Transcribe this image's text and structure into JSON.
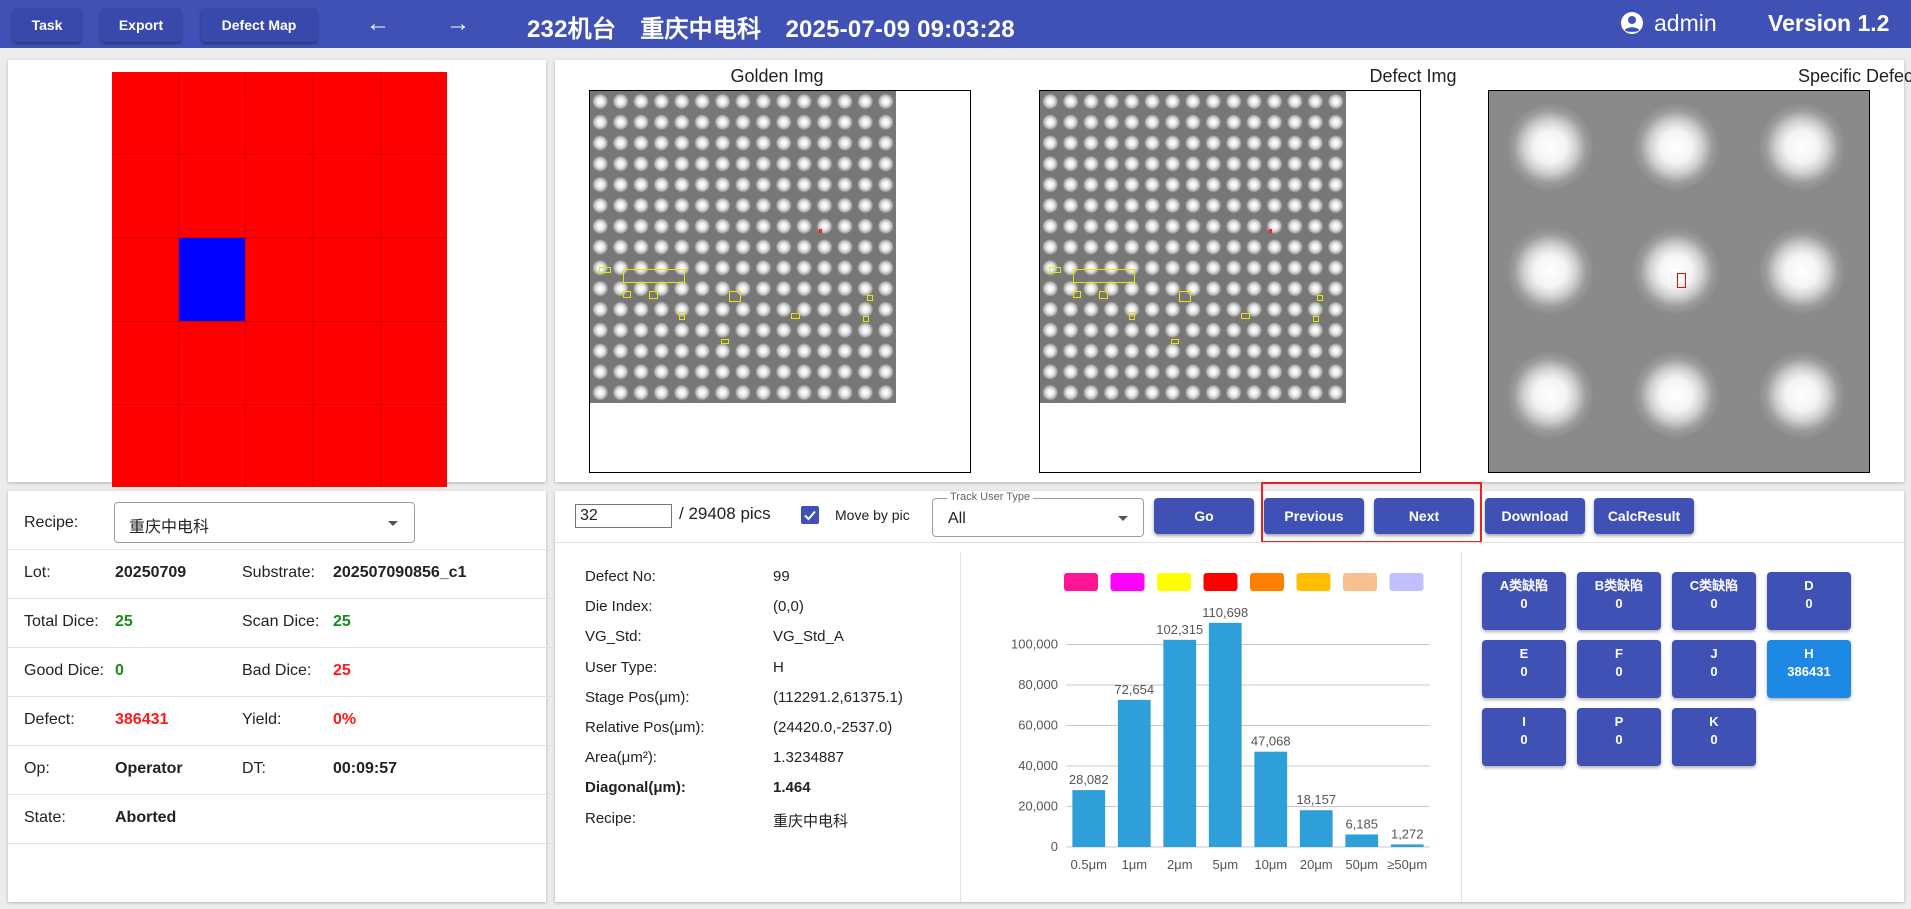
{
  "header": {
    "task": "Task",
    "export": "Export",
    "defect_map": "Defect Map",
    "title": "232机台　重庆中电科　2025-07-09 09:03:28",
    "user": "admin",
    "version": "Version 1.2"
  },
  "images": {
    "golden_title": "Golden Img",
    "defect_title": "Defect Img",
    "specific_title": "Specific Defect"
  },
  "info": {
    "recipe_label": "Recipe:",
    "recipe_value": "重庆中电科",
    "lot_label": "Lot:",
    "lot_value": "20250709",
    "substrate_label": "Substrate:",
    "substrate_value": "202507090856_c1",
    "total_dice_label": "Total Dice:",
    "total_dice_value": "25",
    "scan_dice_label": "Scan Dice:",
    "scan_dice_value": "25",
    "good_dice_label": "Good Dice:",
    "good_dice_value": "0",
    "bad_dice_label": "Bad Dice:",
    "bad_dice_value": "25",
    "defect_label": "Defect:",
    "defect_value": "386431",
    "yield_label": "Yield:",
    "yield_value": "0%",
    "op_label": "Op:",
    "op_value": "Operator",
    "dt_label": "DT:",
    "dt_value": "00:09:57",
    "state_label": "State:",
    "state_value": "Aborted"
  },
  "controls": {
    "pic_index": "32",
    "pic_total": "/ 29408 pics",
    "move_by_pic": "Move by pic",
    "move_by_pic_checked": true,
    "track_user_type_label": "Track User Type",
    "track_user_type_value": "All",
    "go": "Go",
    "previous": "Previous",
    "next": "Next",
    "download": "Download",
    "calc_result": "CalcResult"
  },
  "details": [
    {
      "label": "Defect No:",
      "value": "99"
    },
    {
      "label": "Die Index:",
      "value": "(0,0)"
    },
    {
      "label": "VG_Std:",
      "value": "VG_Std_A"
    },
    {
      "label": "User Type:",
      "value": "H"
    },
    {
      "label": "Stage Pos(μm):",
      "value": "(112291.2,61375.1)"
    },
    {
      "label": "Relative Pos(μm):",
      "value": "(24420.0,-2537.0)"
    },
    {
      "label": "Area(μm²):",
      "value": "1.3234887"
    },
    {
      "label": "Diagonal(μm):",
      "value": "1.464"
    },
    {
      "label": "Recipe:",
      "value": "重庆中电科"
    }
  ],
  "legend_colors": [
    "#ff1493",
    "#ff00ff",
    "#ffff00",
    "#ff0000",
    "#ff8000",
    "#ffbf00",
    "#f9bf8f",
    "#c0c0ff"
  ],
  "chart_data": {
    "type": "bar",
    "categories": [
      "0.5μm",
      "1μm",
      "2μm",
      "5μm",
      "10μm",
      "20μm",
      "50μm",
      "≥50μm"
    ],
    "values": [
      28082,
      72654,
      102315,
      110698,
      47068,
      18157,
      6185,
      1272
    ],
    "value_labels": [
      "28,082",
      "72,654",
      "102,315",
      "110,698",
      "47,068",
      "18,157",
      "6,185",
      "1,272"
    ],
    "yticks": [
      "0",
      "20,000",
      "40,000",
      "60,000",
      "80,000",
      "100,000"
    ],
    "ylim": [
      0,
      120000
    ],
    "bar_color": "#2e9fd8",
    "grid": true
  },
  "categories": [
    {
      "name": "A类缺陷",
      "count": "0"
    },
    {
      "name": "B类缺陷",
      "count": "0"
    },
    {
      "name": "C类缺陷",
      "count": "0"
    },
    {
      "name": "D",
      "count": "0"
    },
    {
      "name": "E",
      "count": "0"
    },
    {
      "name": "F",
      "count": "0"
    },
    {
      "name": "J",
      "count": "0"
    },
    {
      "name": "H",
      "count": "386431"
    },
    {
      "name": "I",
      "count": "0"
    },
    {
      "name": "P",
      "count": "0"
    },
    {
      "name": "K",
      "count": "0"
    }
  ]
}
